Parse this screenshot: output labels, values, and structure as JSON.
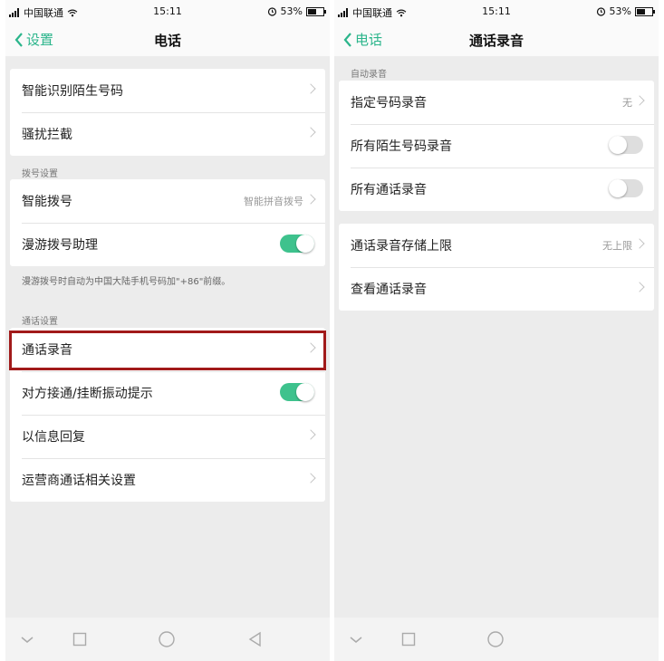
{
  "status_bar": {
    "carrier": "中国联通",
    "time": "15:11",
    "battery": "53%"
  },
  "left_screen": {
    "back_label": "设置",
    "title": "电话",
    "group1": [
      {
        "label": "智能识别陌生号码"
      },
      {
        "label": "骚扰拦截"
      }
    ],
    "dial_section_label": "拨号设置",
    "dial_rows": [
      {
        "label": "智能拨号",
        "value": "智能拼音拨号"
      },
      {
        "label": "漫游拨号助理",
        "toggle": true
      }
    ],
    "roaming_note": "漫游拨号时自动为中国大陆手机号码加\"+86\"前缀。",
    "call_section_label": "通话设置",
    "call_rows": [
      {
        "label": "通话录音"
      },
      {
        "label": "对方接通/挂断振动提示",
        "toggle": true
      },
      {
        "label": "以信息回复"
      },
      {
        "label": "运营商通话相关设置"
      }
    ]
  },
  "right_screen": {
    "back_label": "电话",
    "title": "通话录音",
    "auto_section_label": "自动录音",
    "auto_rows": [
      {
        "label": "指定号码录音",
        "value": "无"
      },
      {
        "label": "所有陌生号码录音",
        "toggle": false
      },
      {
        "label": "所有通话录音",
        "toggle": false
      }
    ],
    "storage_rows": [
      {
        "label": "通话录音存储上限",
        "value": "无上限"
      },
      {
        "label": "查看通话录音"
      }
    ]
  },
  "colors": {
    "accent": "#2bb58b",
    "toggle_on": "#3ec28d",
    "highlight_border": "#a11a1a",
    "background": "#ececec"
  },
  "icons": {
    "back": "chevron-left-icon",
    "row_arrow": "chevron-right-icon",
    "nav_back": "triangle-left-icon",
    "nav_home": "circle-icon",
    "nav_recent": "square-icon",
    "nav_hide": "chevron-down-icon"
  }
}
